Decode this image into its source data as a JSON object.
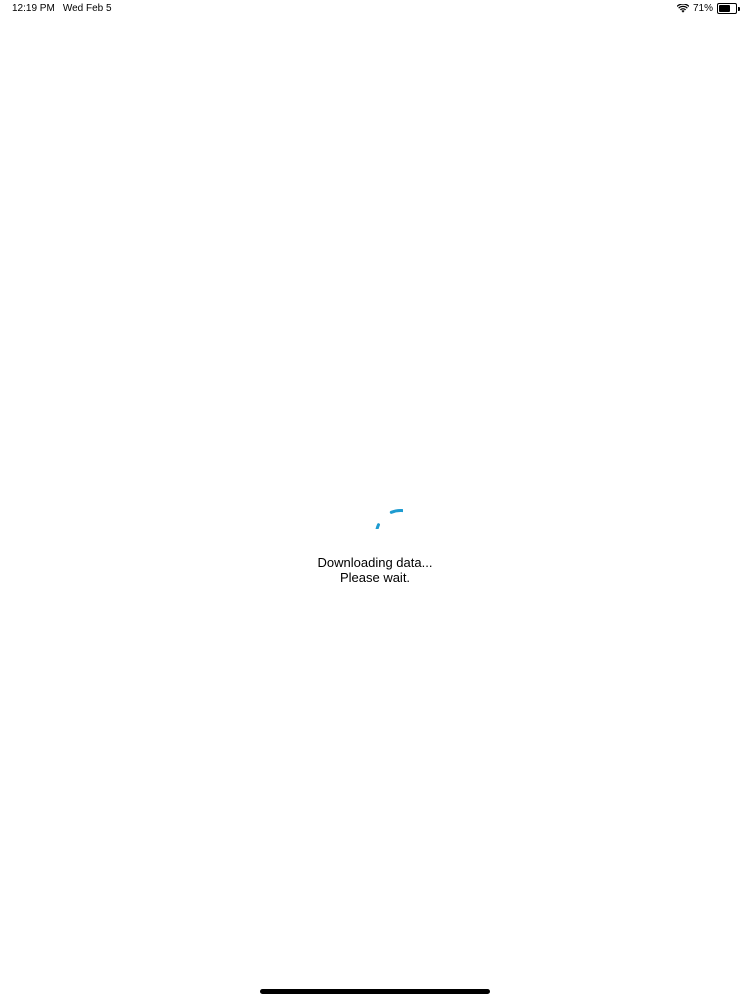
{
  "status_bar": {
    "time": "12:19 PM",
    "date": "Wed Feb 5",
    "battery_percent_label": "71%",
    "battery_level": 0.71,
    "wifi_icon": "wifi-icon",
    "battery_icon": "battery-icon"
  },
  "loader": {
    "spinner_icon": "spinner-icon",
    "accent_color": "#1e9bd0",
    "line1": "Downloading data...",
    "line2": "Please wait."
  }
}
